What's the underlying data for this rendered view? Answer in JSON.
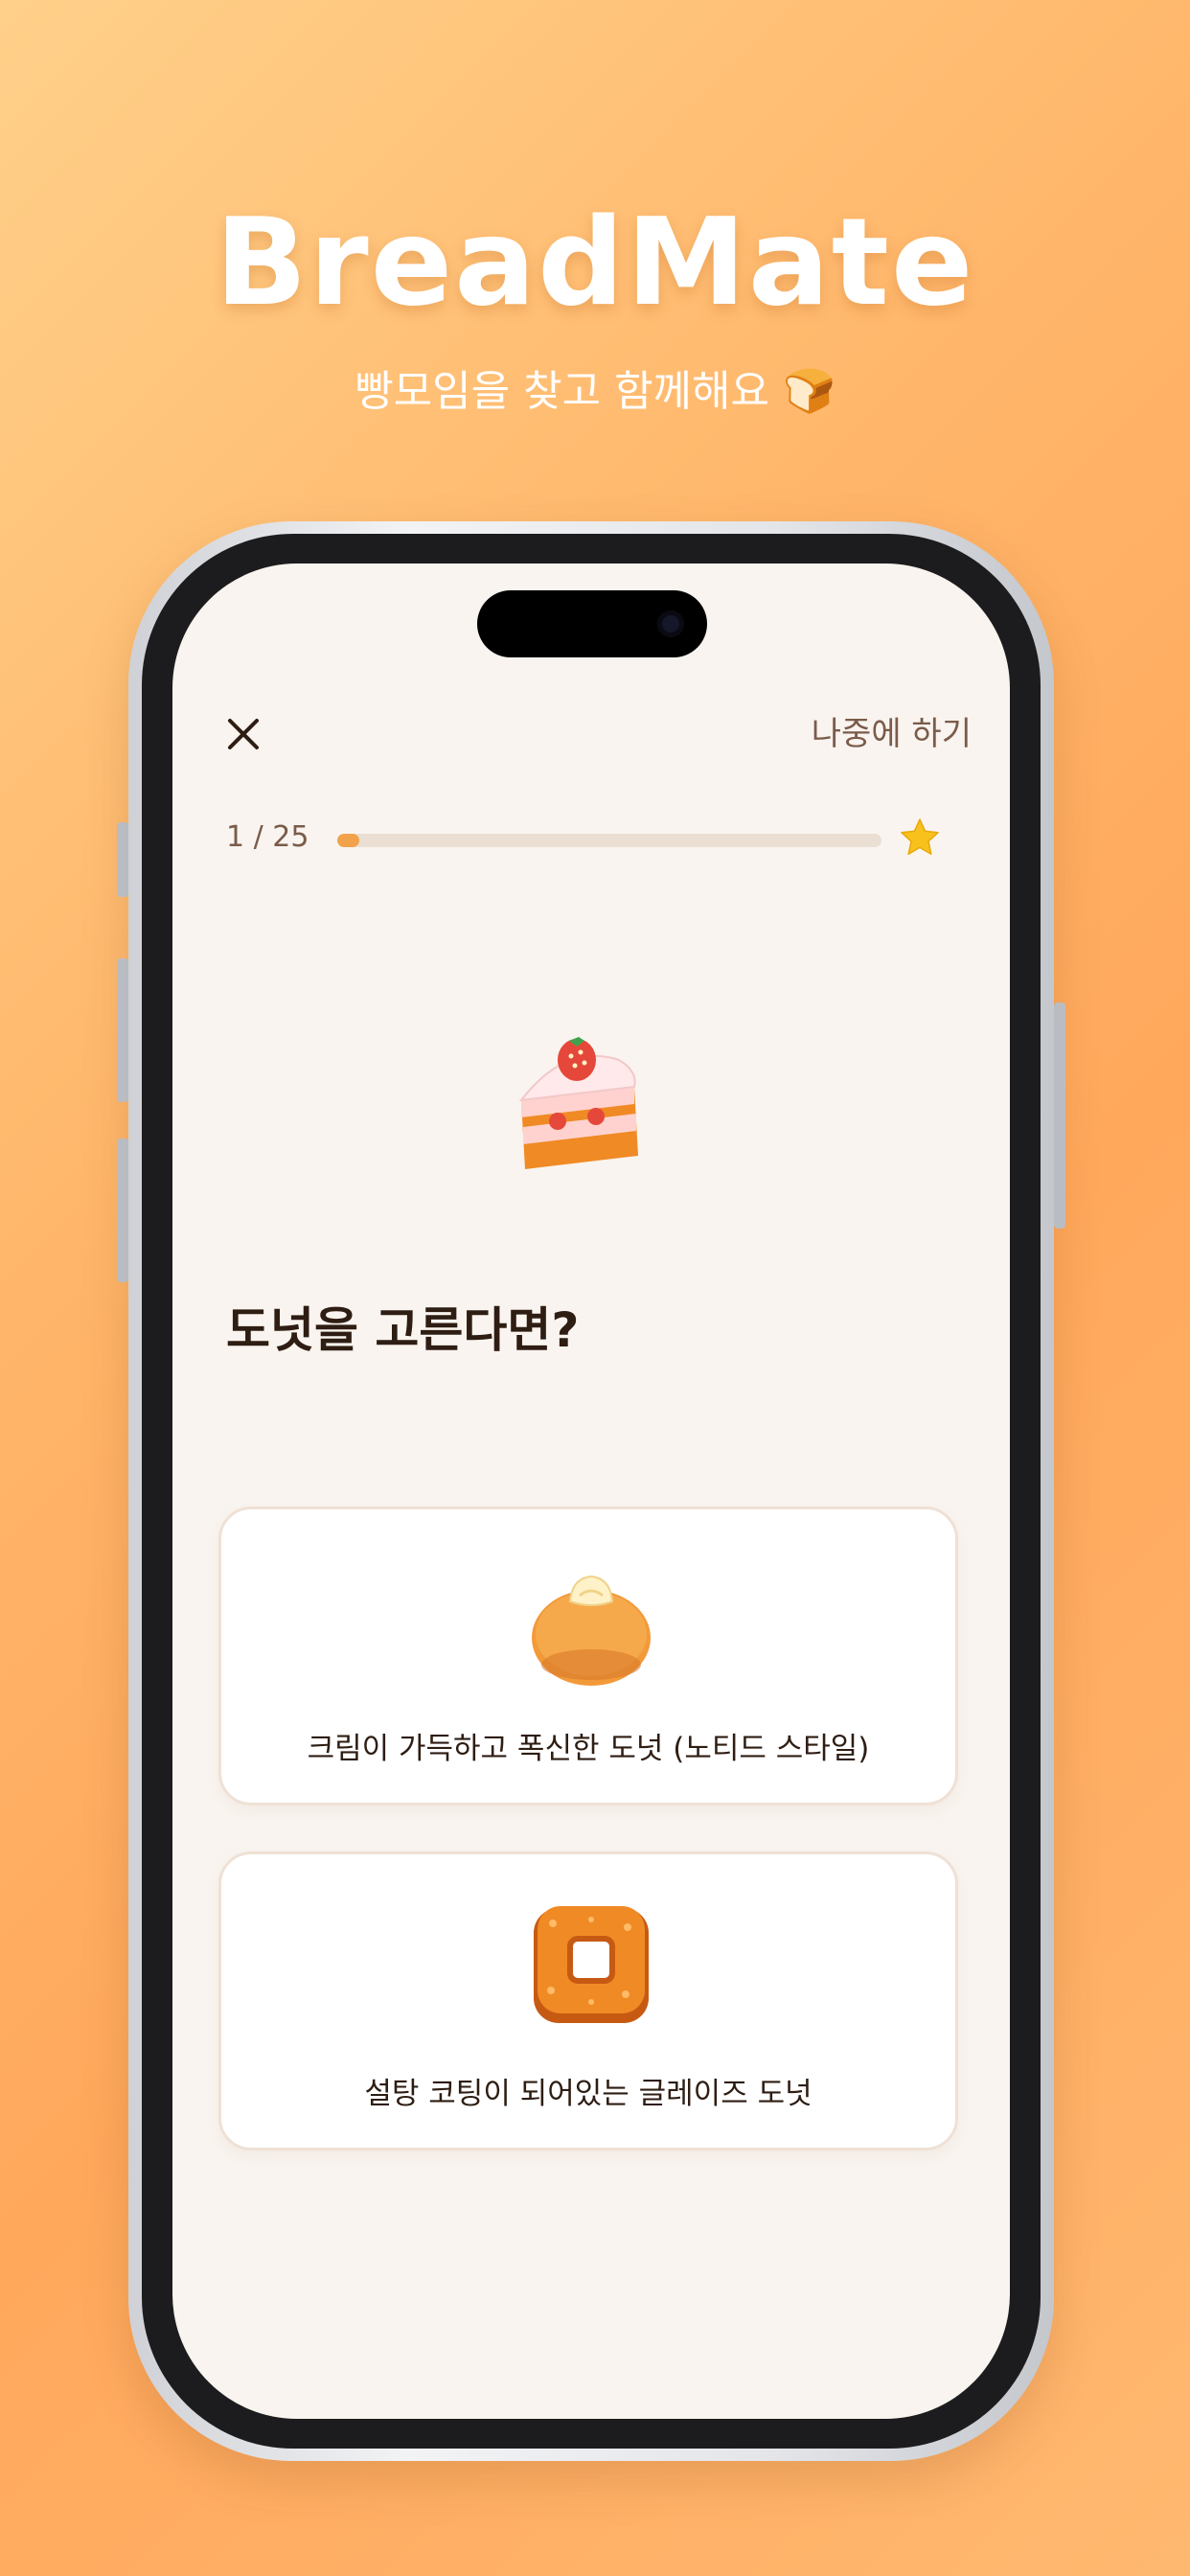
{
  "hero": {
    "title": "BreadMate",
    "subtitle": "빵모임을 찾고 함께해요 🍞"
  },
  "header": {
    "close_icon": "close-icon",
    "later_label": "나중에 하기"
  },
  "progress": {
    "label": "1 / 25",
    "current": 1,
    "total": 25,
    "fraction": 0.04,
    "end_icon": "star-icon"
  },
  "quiz": {
    "illustration": "strawberry-cake-icon",
    "question": "도넛을 고른다면?",
    "options": [
      {
        "icon": "cream-donut-icon",
        "label": "크림이 가득하고 폭신한 도넛 (노티드 스타일)"
      },
      {
        "icon": "glazed-donut-icon",
        "label": "설탕 코팅이 되어있는 글레이즈 도넛"
      }
    ]
  },
  "colors": {
    "background_from": "#ffd08a",
    "background_to": "#ffa85c",
    "screen_bg": "#f9f4ef",
    "text_primary": "#2e1d13",
    "text_secondary": "#7a5b4a",
    "progress_track": "#ebdfd4",
    "star": "#f8c11b"
  }
}
